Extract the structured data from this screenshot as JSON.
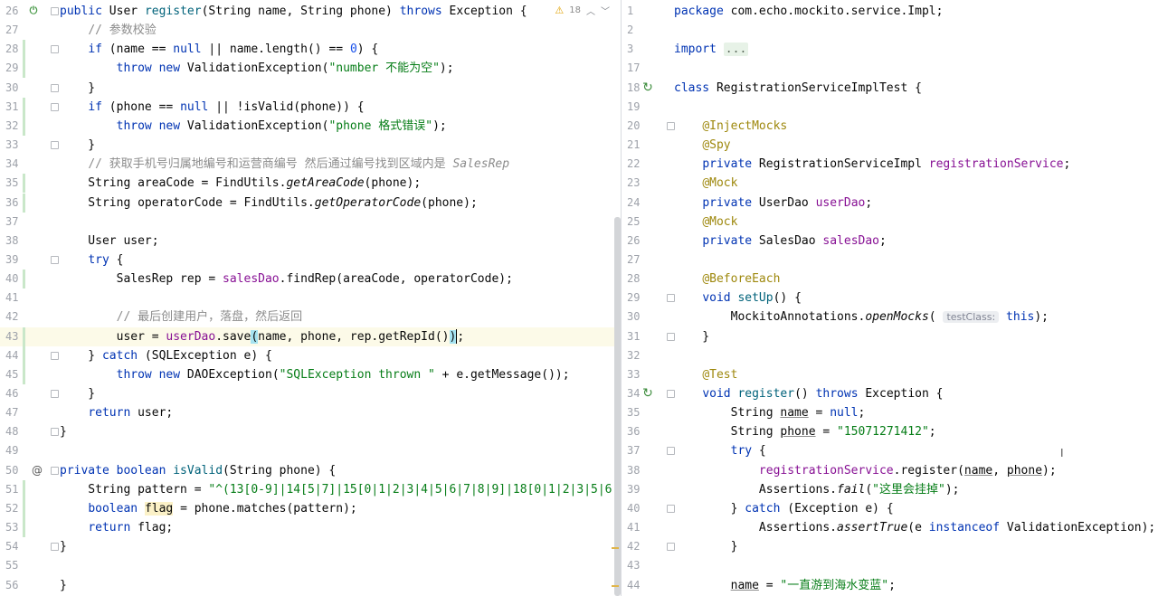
{
  "left_editor": {
    "warnings": {
      "count": "18"
    },
    "lines": [
      {
        "n": "26",
        "html": "<span class=\"kw\">public</span> User <span class=\"mth\">register</span>(String name, String phone) <span class=\"kw\">throws</span> Exception {"
      },
      {
        "n": "27",
        "html": "    <span class=\"cmt\">// 参数校验</span>"
      },
      {
        "n": "28",
        "html": "    <span class=\"kw\">if</span> (name == <span class=\"kw\">null</span> || name.length() == <span class=\"num\">0</span>) {"
      },
      {
        "n": "29",
        "html": "        <span class=\"kw\">throw new</span> ValidationException(<span class=\"str\">\"number 不能为空\"</span>);"
      },
      {
        "n": "30",
        "html": "    }"
      },
      {
        "n": "31",
        "html": "    <span class=\"kw\">if</span> (phone == <span class=\"kw\">null</span> || !isValid(phone)) {"
      },
      {
        "n": "32",
        "html": "        <span class=\"kw\">throw new</span> ValidationException(<span class=\"str\">\"phone 格式错误\"</span>);"
      },
      {
        "n": "33",
        "html": "    }"
      },
      {
        "n": "34",
        "html": "    <span class=\"cmt\">// 获取手机号归属地编号和运营商编号 然后通过编号找到区域内是 <i>SalesRep</i></span>"
      },
      {
        "n": "35",
        "html": "    String areaCode = FindUtils.<span class=\"it\">getAreaCode</span>(phone);"
      },
      {
        "n": "36",
        "html": "    String operatorCode = FindUtils.<span class=\"it\">getOperatorCode</span>(phone);"
      },
      {
        "n": "37",
        "html": ""
      },
      {
        "n": "38",
        "html": "    User user;"
      },
      {
        "n": "39",
        "html": "    <span class=\"kw\">try</span> {"
      },
      {
        "n": "40",
        "html": "        SalesRep rep = <span class=\"fld\">salesDao</span>.findRep(areaCode, operatorCode);"
      },
      {
        "n": "41",
        "html": ""
      },
      {
        "n": "42",
        "html": "        <span class=\"cmt\">// 最后创建用户，落盘，然后返回</span>"
      },
      {
        "n": "43",
        "html": "        user = <span class=\"fld\">userDao</span>.save<span class=\"brace-hl\">(</span>name, phone, rep.getRepId()<span class=\"brace-hl\">)</span><span class=\"caret\"></span>;"
      },
      {
        "n": "44",
        "html": "    } <span class=\"kw\">catch</span> (SQLException e) {"
      },
      {
        "n": "45",
        "html": "        <span class=\"kw\">throw new</span> DAOException(<span class=\"str\">\"SQLException thrown \"</span> + e.getMessage());"
      },
      {
        "n": "46",
        "html": "    }"
      },
      {
        "n": "47",
        "html": "    <span class=\"kw\">return</span> user;"
      },
      {
        "n": "48",
        "html": "}"
      },
      {
        "n": "49",
        "html": ""
      },
      {
        "n": "50",
        "html": "<span class=\"kw\">private boolean</span> <span class=\"mth\">isValid</span>(String phone) {"
      },
      {
        "n": "51",
        "html": "    String pattern = <span class=\"str\">\"^(13[0-9]|14[5|7]|15[0|1|2|3|4|5|6|7|8|9]|18[0|1|2|3|5|6</span>"
      },
      {
        "n": "52",
        "html": "    <span class=\"kw\">boolean</span> <span class=\"hl-bg\">flag</span> = phone.matches(pattern);"
      },
      {
        "n": "53",
        "html": "    <span class=\"kw\">return</span> flag;"
      },
      {
        "n": "54",
        "html": "}"
      },
      {
        "n": "55",
        "html": ""
      },
      {
        "n": "56",
        "html": "}"
      }
    ]
  },
  "right_editor": {
    "lines": [
      {
        "n": "1",
        "html": "<span class=\"kw\">package</span> com.echo.mockito.service.Impl;"
      },
      {
        "n": "2",
        "html": ""
      },
      {
        "n": "3",
        "html": "<span class=\"kw\">import</span> <span class=\"folded\">...</span>"
      },
      {
        "n": "17",
        "html": ""
      },
      {
        "n": "18",
        "html": "<span class=\"kw\">class</span> RegistrationServiceImplTest {"
      },
      {
        "n": "19",
        "html": ""
      },
      {
        "n": "20",
        "html": "    <span class=\"ann\">@InjectMocks</span>"
      },
      {
        "n": "21",
        "html": "    <span class=\"ann\">@Spy</span>"
      },
      {
        "n": "22",
        "html": "    <span class=\"kw\">private</span> RegistrationServiceImpl <span class=\"fld\">registrationService</span>;"
      },
      {
        "n": "23",
        "html": "    <span class=\"ann\">@Mock</span>"
      },
      {
        "n": "24",
        "html": "    <span class=\"kw\">private</span> UserDao <span class=\"fld\">userDao</span>;"
      },
      {
        "n": "25",
        "html": "    <span class=\"ann\">@Mock</span>"
      },
      {
        "n": "26",
        "html": "    <span class=\"kw\">private</span> SalesDao <span class=\"fld\">salesDao</span>;"
      },
      {
        "n": "27",
        "html": ""
      },
      {
        "n": "28",
        "html": "    <span class=\"ann\">@BeforeEach</span>"
      },
      {
        "n": "29",
        "html": "    <span class=\"kw\">void</span> <span class=\"mth\">setUp</span>() {"
      },
      {
        "n": "30",
        "html": "        MockitoAnnotations.<span class=\"it\">openMocks</span>( <span class=\"hint\">testClass:</span> <span class=\"kw\">this</span>);"
      },
      {
        "n": "31",
        "html": "    }"
      },
      {
        "n": "32",
        "html": ""
      },
      {
        "n": "33",
        "html": "    <span class=\"ann\">@Test</span>"
      },
      {
        "n": "34",
        "html": "    <span class=\"kw\">void</span> <span class=\"mth\">register</span>() <span class=\"kw\">throws</span> Exception {"
      },
      {
        "n": "35",
        "html": "        String <span class=\"uline\">name</span> = <span class=\"kw\">null</span>;"
      },
      {
        "n": "36",
        "html": "        String <span class=\"uline\">phone</span> = <span class=\"str\">\"15071271412\"</span>;"
      },
      {
        "n": "37",
        "html": "        <span class=\"kw\">try</span> {"
      },
      {
        "n": "38",
        "html": "            <span class=\"fld\">registrationService</span>.register(<span class=\"uline\">name</span>, <span class=\"uline\">phone</span>);"
      },
      {
        "n": "39",
        "html": "            Assertions.<span class=\"it\">fail</span>(<span class=\"str\">\"这里会挂掉\"</span>);"
      },
      {
        "n": "40",
        "html": "        } <span class=\"kw\">catch</span> (Exception e) {"
      },
      {
        "n": "41",
        "html": "            Assertions.<span class=\"it\">assertTrue</span>(e <span class=\"kw\">instanceof</span> ValidationException);"
      },
      {
        "n": "42",
        "html": "        }"
      },
      {
        "n": "43",
        "html": ""
      },
      {
        "n": "44",
        "html": "        <span class=\"uline\">name</span> = <span class=\"str\">\"一直游到海水变蓝\"</span>;"
      }
    ]
  }
}
